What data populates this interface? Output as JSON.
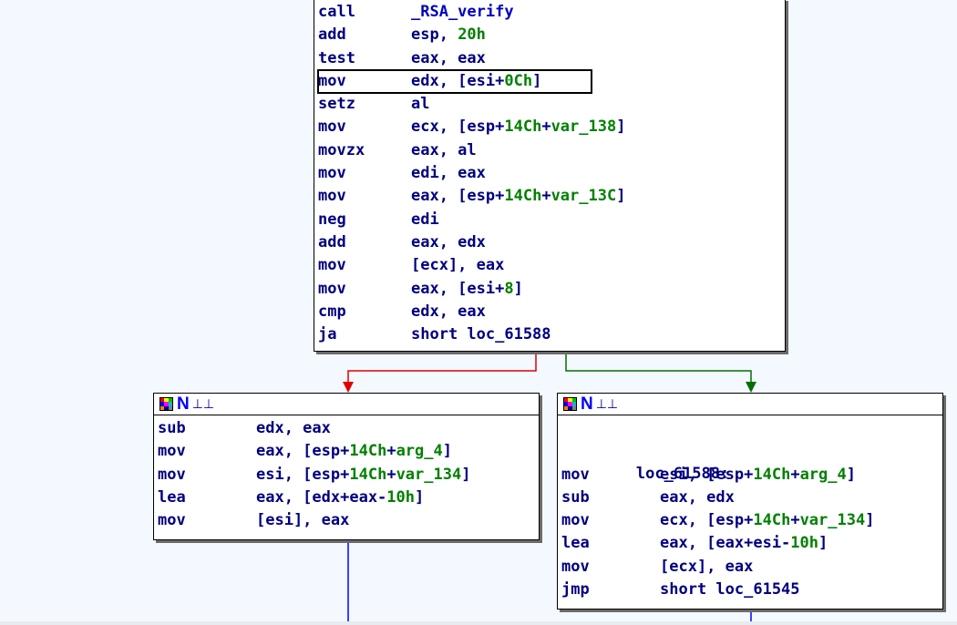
{
  "top_block": {
    "lines": [
      {
        "mn": "call",
        "ops": [
          {
            "t": "_RSA_verify",
            "c": "fn"
          }
        ]
      },
      {
        "mn": "add",
        "ops": [
          {
            "t": "esp, ",
            "c": "reg"
          },
          {
            "t": "20h",
            "c": "num"
          }
        ]
      },
      {
        "mn": "test",
        "ops": [
          {
            "t": "eax, eax",
            "c": "reg"
          }
        ]
      },
      {
        "mn": "mov",
        "ops": [
          {
            "t": "edx, [esi+",
            "c": "reg"
          },
          {
            "t": "0Ch",
            "c": "num"
          },
          {
            "t": "]",
            "c": "reg"
          }
        ],
        "highlight": true
      },
      {
        "mn": "setz",
        "ops": [
          {
            "t": "al",
            "c": "reg"
          }
        ]
      },
      {
        "mn": "mov",
        "ops": [
          {
            "t": "ecx, [esp+",
            "c": "reg"
          },
          {
            "t": "14Ch",
            "c": "num"
          },
          {
            "t": "+",
            "c": "reg"
          },
          {
            "t": "var_138",
            "c": "num"
          },
          {
            "t": "]",
            "c": "reg"
          }
        ]
      },
      {
        "mn": "movzx",
        "ops": [
          {
            "t": "eax, al",
            "c": "reg"
          }
        ]
      },
      {
        "mn": "mov",
        "ops": [
          {
            "t": "edi, eax",
            "c": "reg"
          }
        ]
      },
      {
        "mn": "mov",
        "ops": [
          {
            "t": "eax, [esp+",
            "c": "reg"
          },
          {
            "t": "14Ch",
            "c": "num"
          },
          {
            "t": "+",
            "c": "reg"
          },
          {
            "t": "var_13C",
            "c": "num"
          },
          {
            "t": "]",
            "c": "reg"
          }
        ]
      },
      {
        "mn": "neg",
        "ops": [
          {
            "t": "edi",
            "c": "reg"
          }
        ]
      },
      {
        "mn": "add",
        "ops": [
          {
            "t": "eax, edx",
            "c": "reg"
          }
        ]
      },
      {
        "mn": "mov",
        "ops": [
          {
            "t": "[ecx], eax",
            "c": "reg"
          }
        ]
      },
      {
        "mn": "mov",
        "ops": [
          {
            "t": "eax, [esi+",
            "c": "reg"
          },
          {
            "t": "8",
            "c": "num"
          },
          {
            "t": "]",
            "c": "reg"
          }
        ]
      },
      {
        "mn": "cmp",
        "ops": [
          {
            "t": "edx, eax",
            "c": "reg"
          }
        ]
      },
      {
        "mn": "ja",
        "ops": [
          {
            "t": "short loc_61588",
            "c": "reg"
          }
        ]
      }
    ]
  },
  "left_block": {
    "header_icons": [
      "color-grid-icon",
      "n-icon",
      "graph-view-icon"
    ],
    "lines": [
      {
        "mn": "sub",
        "ops": [
          {
            "t": "edx, eax",
            "c": "reg"
          }
        ]
      },
      {
        "mn": "mov",
        "ops": [
          {
            "t": "eax, [esp+",
            "c": "reg"
          },
          {
            "t": "14Ch",
            "c": "num"
          },
          {
            "t": "+",
            "c": "reg"
          },
          {
            "t": "arg_4",
            "c": "num"
          },
          {
            "t": "]",
            "c": "reg"
          }
        ]
      },
      {
        "mn": "mov",
        "ops": [
          {
            "t": "esi, [esp+",
            "c": "reg"
          },
          {
            "t": "14Ch",
            "c": "num"
          },
          {
            "t": "+",
            "c": "reg"
          },
          {
            "t": "var_134",
            "c": "num"
          },
          {
            "t": "]",
            "c": "reg"
          }
        ]
      },
      {
        "mn": "lea",
        "ops": [
          {
            "t": "eax, [edx+eax-",
            "c": "reg"
          },
          {
            "t": "10h",
            "c": "num"
          },
          {
            "t": "]",
            "c": "reg"
          }
        ]
      },
      {
        "mn": "mov",
        "ops": [
          {
            "t": "[esi], eax",
            "c": "reg"
          }
        ]
      }
    ]
  },
  "right_block": {
    "header_icons": [
      "color-grid-icon",
      "n-icon",
      "graph-view-icon"
    ],
    "label": "loc_61588:",
    "lines": [
      {
        "mn": "mov",
        "ops": [
          {
            "t": "esi, [esp+",
            "c": "reg"
          },
          {
            "t": "14Ch",
            "c": "num"
          },
          {
            "t": "+",
            "c": "reg"
          },
          {
            "t": "arg_4",
            "c": "num"
          },
          {
            "t": "]",
            "c": "reg"
          }
        ]
      },
      {
        "mn": "sub",
        "ops": [
          {
            "t": "eax, edx",
            "c": "reg"
          }
        ]
      },
      {
        "mn": "mov",
        "ops": [
          {
            "t": "ecx, [esp+",
            "c": "reg"
          },
          {
            "t": "14Ch",
            "c": "num"
          },
          {
            "t": "+",
            "c": "reg"
          },
          {
            "t": "var_134",
            "c": "num"
          },
          {
            "t": "]",
            "c": "reg"
          }
        ]
      },
      {
        "mn": "lea",
        "ops": [
          {
            "t": "eax, [eax+esi-",
            "c": "reg"
          },
          {
            "t": "10h",
            "c": "num"
          },
          {
            "t": "]",
            "c": "reg"
          }
        ]
      },
      {
        "mn": "mov",
        "ops": [
          {
            "t": "[ecx], eax",
            "c": "reg"
          }
        ]
      },
      {
        "mn": "jmp",
        "ops": [
          {
            "t": "short loc_61545",
            "c": "reg"
          }
        ]
      }
    ]
  },
  "colors": {
    "background": "#f4f9ff",
    "edge_false": "#e00000",
    "edge_true": "#007000",
    "edge_normal": "#0000ff",
    "mnemonic": "#000080",
    "immediate": "#008000"
  }
}
